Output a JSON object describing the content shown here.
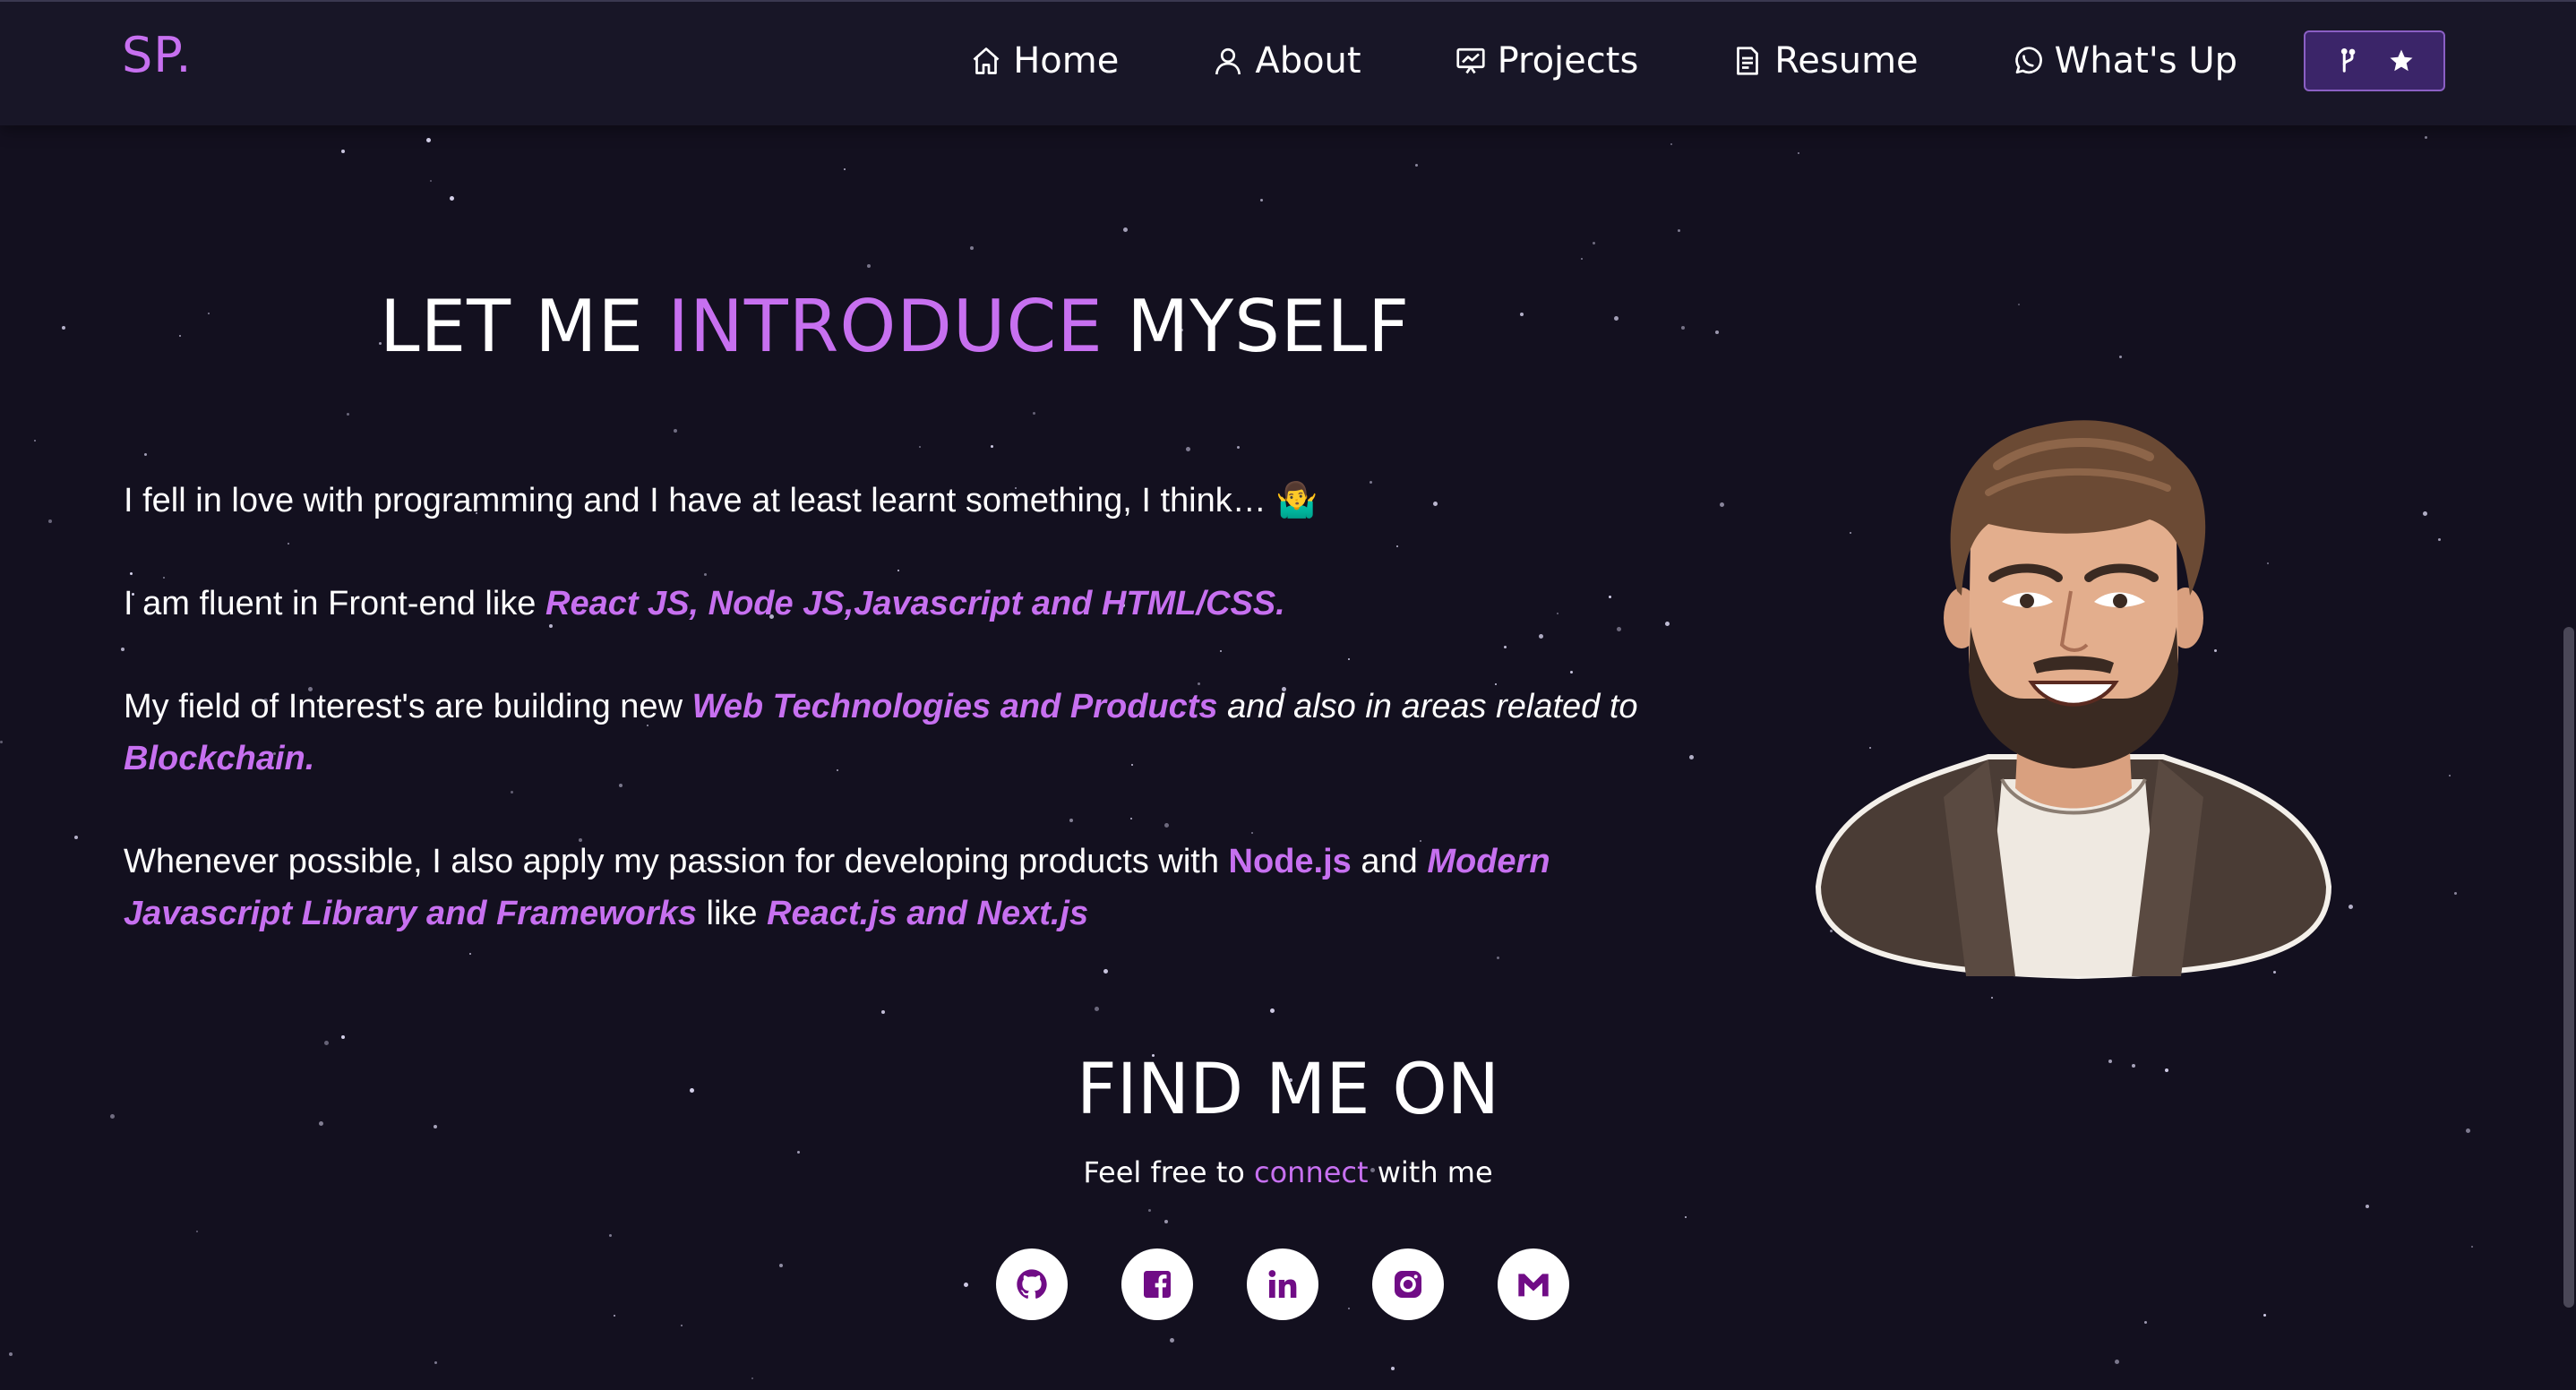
{
  "brand": "SP.",
  "nav": {
    "home": "Home",
    "about": "About",
    "projects": "Projects",
    "resume": "Resume",
    "whatsup": "What's Up"
  },
  "intro": {
    "heading_pre": "LET ME ",
    "heading_accent": "INTRODUCE",
    "heading_post": " MYSELF",
    "p1": "I fell in love with programming and I have at least learnt something, I think… 🤷‍♂️",
    "p2_pre": "I am fluent in Front-end like ",
    "p2_accent": "React JS, Node JS,Javascript and HTML/CSS.",
    "p3_pre": "My field of Interest's are building new  ",
    "p3_accent1": "Web Technologies and Products",
    "p3_mid": " and also in areas related to ",
    "p3_accent2": "Blockchain.",
    "p4_pre": "Whenever possible, I also apply my passion for developing products with ",
    "p4_accent1": "Node.js",
    "p4_mid": " and ",
    "p4_accent2": "Modern Javascript Library and Frameworks",
    "p4_mid2": "  like ",
    "p4_accent3": "React.js and Next.js"
  },
  "find": {
    "title": "FIND ME ON",
    "sub_pre": "Feel free to ",
    "sub_accent": "connect",
    "sub_post": " with me"
  },
  "socials": [
    "github-icon",
    "facebook-icon",
    "linkedin-icon",
    "instagram-icon",
    "gmail-icon"
  ],
  "colors": {
    "accent": "#c770f0",
    "background": "#13101f",
    "navbar": "#181627",
    "button": "#3b2569",
    "social_icon": "#700c86"
  }
}
